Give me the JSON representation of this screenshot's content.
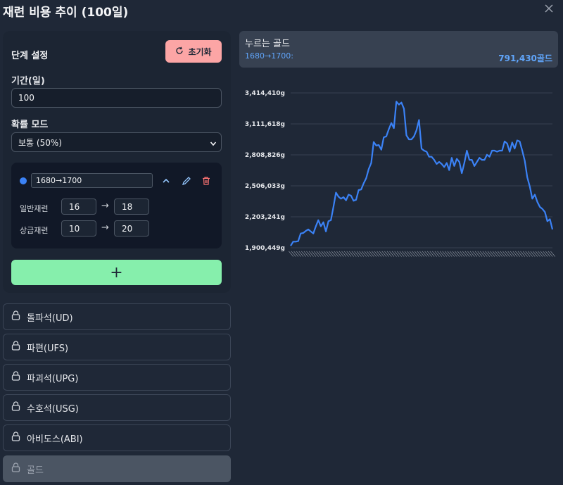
{
  "window": {
    "title": "재련 비용 추이 (100일)"
  },
  "stage": {
    "title": "단계 설정",
    "reset_label": "초기화",
    "period_label": "기간(일)",
    "period_value": "100",
    "prob_label": "확률 모드",
    "prob_value": "보통 (50%)",
    "range": {
      "value": "1680→1700",
      "rows": [
        {
          "label": "일반재련",
          "from": "16",
          "to": "18"
        },
        {
          "label": "상급재련",
          "from": "10",
          "to": "20"
        }
      ]
    },
    "add_label": "+"
  },
  "materials": [
    {
      "label": "돌파석(UD)"
    },
    {
      "label": "파편(UFS)"
    },
    {
      "label": "파괴석(UPG)"
    },
    {
      "label": "수호석(USG)"
    },
    {
      "label": "아비도스(ABI)"
    },
    {
      "label": "골드"
    }
  ],
  "gold": {
    "title": "누르는 골드",
    "range": "1680→1700:",
    "total": "791,430골드"
  },
  "colors": {
    "line": "#3b82f6",
    "reset": "#fca5a5",
    "add": "#86efac",
    "accent": "#60a5fa"
  },
  "chart_data": {
    "type": "line",
    "title": "",
    "xlabel": "",
    "ylabel": "",
    "ylim": [
      1900449,
      3414410
    ],
    "y_ticks": [
      "1,900,449g",
      "2,203,241g",
      "2,506,033g",
      "2,808,826g",
      "3,111,618g",
      "3,414,410g"
    ],
    "grid": true,
    "series": [
      {
        "values": [
          1920000,
          1960000,
          1960000,
          1965000,
          2040000,
          2045000,
          2065000,
          2080000,
          2060000,
          2040000,
          2110000,
          2170000,
          2110000,
          2150000,
          2060000,
          2160000,
          2170000,
          2300000,
          2440000,
          2400000,
          2380000,
          2395000,
          2365000,
          2420000,
          2410000,
          2360000,
          2370000,
          2465000,
          2470000,
          2530000,
          2580000,
          2670000,
          2730000,
          2935000,
          2900000,
          2905000,
          2860000,
          2980000,
          2990000,
          3060000,
          3120000,
          3070000,
          3330000,
          3300000,
          3320000,
          3260000,
          3000000,
          2960000,
          2960000,
          2990000,
          3050000,
          3150000,
          2870000,
          2850000,
          2840000,
          2790000,
          2790000,
          2760000,
          2720000,
          2740000,
          2720000,
          2690000,
          2730000,
          2660000,
          2780000,
          2700000,
          2770000,
          2740000,
          2630000,
          2730000,
          2850000,
          2760000,
          2760000,
          2700000,
          2740000,
          2780000,
          2760000,
          2760000,
          2810000,
          2790000,
          2850000,
          2850000,
          2840000,
          2850000,
          2850000,
          2940000,
          2920000,
          2840000,
          2930000,
          2870000,
          2950000,
          2940000,
          2850000,
          2750000,
          2590000,
          2500000,
          2380000,
          2420000,
          2350000,
          2300000,
          2280000,
          2250000,
          2160000,
          2180000,
          2080000
        ]
      }
    ]
  }
}
